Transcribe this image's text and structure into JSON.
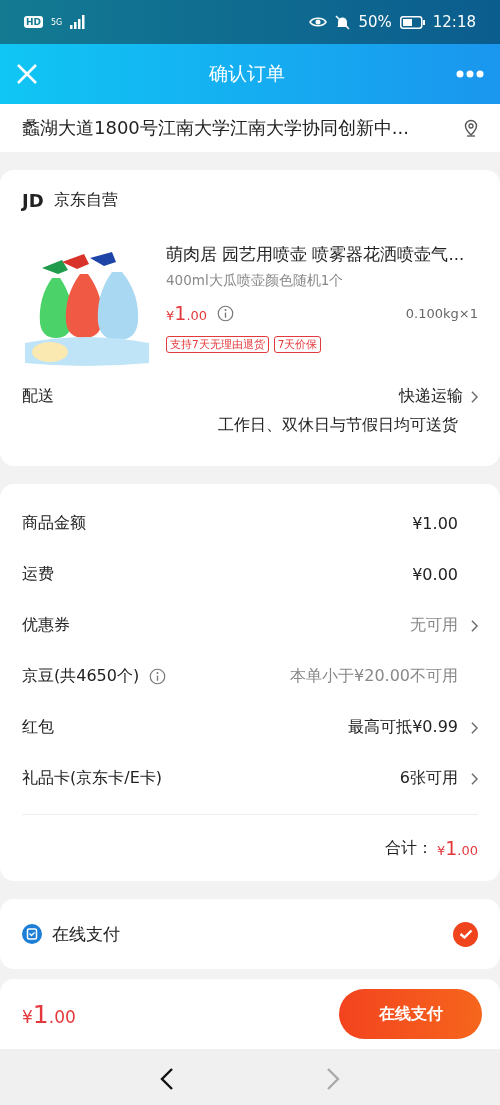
{
  "status_bar": {
    "left": "HD",
    "network": "5G",
    "battery": "50%",
    "time": "12:18"
  },
  "header": {
    "title": "确认订单"
  },
  "address": {
    "text": "蠡湖大道1800号江南大学江南大学协同创新中..."
  },
  "shop": {
    "logo": "JD",
    "name": "京东自营"
  },
  "product": {
    "title": "萌肉居 园艺用喷壶 喷雾器花洒喷壶气...",
    "spec": "400ml大瓜喷壶颜色随机1个",
    "price": "¥1.00",
    "weight": "0.100kg×1",
    "tags": [
      "支持7天无理由退货",
      "7天价保"
    ]
  },
  "delivery": {
    "label": "配送",
    "method": "快递运输",
    "note": "工作日、双休日与节假日均可送货"
  },
  "fees": [
    {
      "label": "商品金额",
      "value": "¥1.00",
      "muted": false,
      "chevron": false,
      "info": false
    },
    {
      "label": "运费",
      "value": "¥0.00",
      "muted": false,
      "chevron": false,
      "info": false
    },
    {
      "label": "优惠券",
      "value": "无可用",
      "muted": true,
      "chevron": true,
      "info": false
    },
    {
      "label": "京豆(共4650个)",
      "value": "本单小于¥20.00不可用",
      "muted": true,
      "chevron": false,
      "info": true
    },
    {
      "label": "红包",
      "value": "最高可抵¥0.99",
      "muted": false,
      "chevron": true,
      "info": false
    },
    {
      "label": "礼品卡(京东卡/E卡)",
      "value": "6张可用",
      "muted": false,
      "chevron": true,
      "info": false
    }
  ],
  "total": {
    "label": "合计：",
    "value": "¥1.00"
  },
  "payment_options": [
    {
      "label": "在线支付",
      "selected": true
    }
  ],
  "footer": {
    "price": "¥1.00",
    "button": "在线支付"
  },
  "nav": {
    "back_disabled": false,
    "forward_disabled": true
  }
}
